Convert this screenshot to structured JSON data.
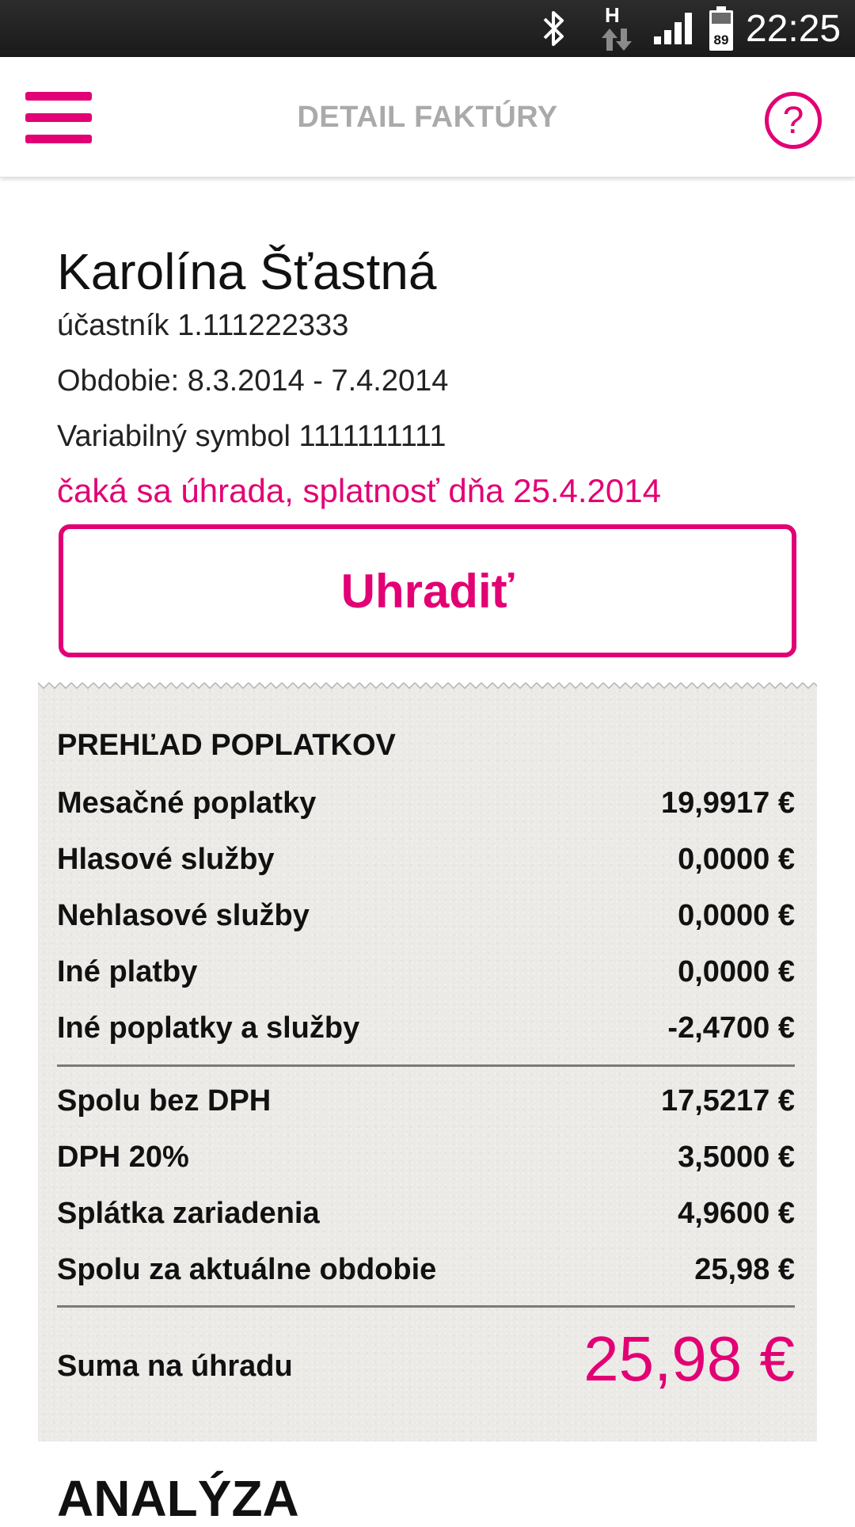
{
  "status_bar": {
    "time": "22:25",
    "network_type": "H",
    "battery_level": "89",
    "icons": [
      "bluetooth-icon",
      "data-arrows-icon",
      "signal-icon",
      "battery-icon"
    ]
  },
  "app_bar": {
    "title": "DETAIL FAKTÚRY",
    "menu_icon": "hamburger-menu-icon",
    "help_icon": "help-question-icon",
    "help_glyph": "?"
  },
  "invoice": {
    "customer_name": "Karolína Šťastná",
    "participant": "účastník 1.111222333",
    "period": "Obdobie: 8.3.2014 - 7.4.2014",
    "variable_symbol": "Variabilný symbol 1111111111",
    "status": "čaká sa úhrada, splatnosť dňa 25.4.2014",
    "pay_button_label": "Uhradiť"
  },
  "overview": {
    "title": "PREHĽAD POPLATKOV",
    "charges": [
      {
        "label": "Mesačné poplatky",
        "value": "19,9917 €"
      },
      {
        "label": "Hlasové služby",
        "value": "0,0000 €"
      },
      {
        "label": "Nehlasové služby",
        "value": "0,0000 €"
      },
      {
        "label": "Iné platby",
        "value": "0,0000 €"
      },
      {
        "label": "Iné poplatky a služby",
        "value": "-2,4700 €"
      }
    ],
    "summary": [
      {
        "label": "Spolu bez DPH",
        "value": "17,5217 €"
      },
      {
        "label": "DPH 20%",
        "value": "3,5000 €"
      },
      {
        "label": "Splátka zariadenia",
        "value": "4,9600 €"
      },
      {
        "label": "Spolu za aktuálne obdobie",
        "value": "25,98 €"
      }
    ],
    "total_label": "Suma na úhradu",
    "total_value": "25,98 €"
  },
  "analysis": {
    "heading": "ANALÝZA"
  },
  "colors": {
    "accent": "#e20074",
    "receipt_background": "#ebeae6",
    "title_gray": "#aaaaaa"
  }
}
